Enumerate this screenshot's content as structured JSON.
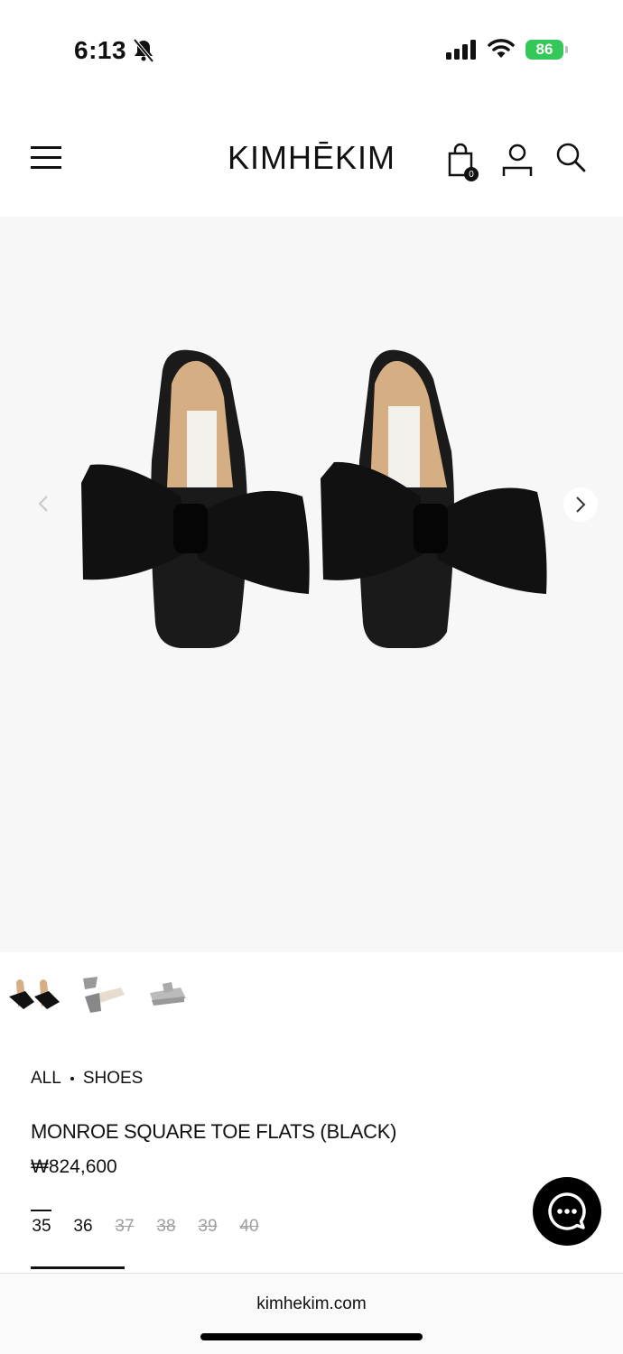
{
  "status_bar": {
    "time": "6:13",
    "battery": "86"
  },
  "header": {
    "logo": "KIMHĒKIM",
    "cart_count": "0",
    "icons": [
      "menu-icon",
      "shopping-bag-icon",
      "user-icon",
      "search-icon"
    ]
  },
  "gallery": {
    "thumbnails": [
      "thumbnail-front",
      "thumbnail-angle",
      "thumbnail-side"
    ]
  },
  "breadcrumb": {
    "items": [
      "ALL",
      "SHOES"
    ]
  },
  "product": {
    "title": "MONROE SQUARE TOE FLATS (BLACK)",
    "price": "₩824,600",
    "sizes": [
      {
        "label": "35",
        "available": true,
        "selected": true
      },
      {
        "label": "36",
        "available": true,
        "selected": false
      },
      {
        "label": "37",
        "available": false,
        "selected": false
      },
      {
        "label": "38",
        "available": false,
        "selected": false
      },
      {
        "label": "39",
        "available": false,
        "selected": false
      },
      {
        "label": "40",
        "available": false,
        "selected": false
      }
    ]
  },
  "browser": {
    "url": "kimhekim.com"
  },
  "colors": {
    "battery": "#34c759",
    "accent": "#111111",
    "gallery_bg": "#f7f7f8"
  }
}
